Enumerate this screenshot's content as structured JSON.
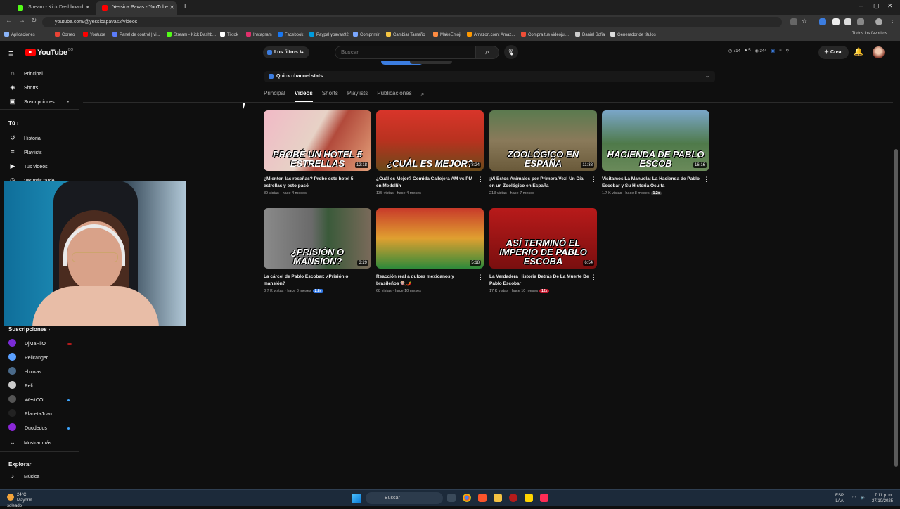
{
  "browser": {
    "tabs": [
      {
        "title": "Stream - Kick Dashboard",
        "color": "#53fc18",
        "active": false
      },
      {
        "title": "Yessica Pavas - YouTube",
        "color": "#ff0000",
        "active": true
      }
    ],
    "url": "youtube.com/@yessicapavas2/videos",
    "bookmarks": [
      {
        "label": "Aplicaciones",
        "color": "#8ab4f8"
      },
      {
        "label": "Correo",
        "color": "#ea4335"
      },
      {
        "label": "Youtube",
        "color": "#ff0000"
      },
      {
        "label": "Panel de control | vi...",
        "color": "#5b7cfa"
      },
      {
        "label": "Stream - Kick Dashb...",
        "color": "#53fc18"
      },
      {
        "label": "Tiktok",
        "color": "#ffffff"
      },
      {
        "label": "Instagram",
        "color": "#e1306c"
      },
      {
        "label": "Facebook",
        "color": "#1877f2"
      },
      {
        "label": "Paypal ypavas92",
        "color": "#009cde"
      },
      {
        "label": "Comprimir",
        "color": "#7aa7ff"
      },
      {
        "label": "Cambiar Tamaño",
        "color": "#f5c542"
      },
      {
        "label": "MakeEmoji",
        "color": "#ff8c42"
      },
      {
        "label": "Amazon.com: Amaz...",
        "color": "#ff9900"
      },
      {
        "label": "Compra tus videojuj...",
        "color": "#f04e37"
      },
      {
        "label": "Daniel Sofia",
        "color": "#cccccc"
      },
      {
        "label": "Generador de títulos",
        "color": "#dddddd"
      }
    ],
    "all_favorites": "Todos los favoritos"
  },
  "yt": {
    "logo_text": "YouTube",
    "logo_sup": "CO",
    "filters_label": "Los filtros",
    "search_placeholder": "Buscar",
    "stats": [
      "714",
      "5",
      "344"
    ],
    "create_label": "Crear"
  },
  "sidebar": {
    "main": [
      {
        "label": "Principal",
        "icon": "home-icon",
        "glyph": "⌂"
      },
      {
        "label": "Shorts",
        "icon": "shorts-icon",
        "glyph": "◈"
      },
      {
        "label": "Suscripciones",
        "icon": "subscriptions-icon",
        "glyph": "▣"
      }
    ],
    "you_label": "Tú",
    "you_items": [
      {
        "label": "Historial",
        "icon": "history-icon",
        "glyph": "↺"
      },
      {
        "label": "Playlists",
        "icon": "playlists-icon",
        "glyph": "≡"
      },
      {
        "label": "Tus videos",
        "icon": "your-videos-icon",
        "glyph": "▶"
      },
      {
        "label": "Ver más tarde",
        "icon": "watch-later-icon",
        "glyph": "◷"
      }
    ],
    "subs_label": "Suscripciones",
    "channels": [
      {
        "label": "DjMaRiiO",
        "color": "#7a2bd6",
        "live": "red"
      },
      {
        "label": "Pelicanger",
        "color": "#5aa0ff",
        "live": ""
      },
      {
        "label": "elxokas",
        "color": "#4a6a8a",
        "live": ""
      },
      {
        "label": "Peli",
        "color": "#cccccc",
        "live": ""
      },
      {
        "label": "WestCOL",
        "color": "#555555",
        "live": "blue"
      },
      {
        "label": "PlanetaJuan",
        "color": "#222222",
        "live": ""
      },
      {
        "label": "Duodedos",
        "color": "#8b28d8",
        "live": "blue"
      }
    ],
    "show_more": "Mostrar más",
    "explore_label": "Explorar",
    "explore_items": [
      {
        "label": "Música",
        "icon": "music-icon",
        "glyph": "♪"
      }
    ]
  },
  "channel": {
    "quick_stats": "Quick channel stats",
    "tabs": [
      "Principal",
      "Videos",
      "Shorts",
      "Playlists",
      "Publicaciones"
    ],
    "active_tab": "Videos"
  },
  "videos": [
    {
      "title": "¿Mienten las reseñas? Probé este hotel 5 estrellas y esto pasó",
      "views": "89 vistas",
      "age": "hace 4 meses",
      "duration": "12:18",
      "caption": "PROBÉ UN HOTEL 5 ESTRELLAS",
      "bg": "linear-gradient(120deg,#f1b9c6 0%,#e7d2c6 45%,#b24a3b 60%,#e3a07a 100%)",
      "badge": "",
      "badge_color": ""
    },
    {
      "title": "¿Cuál es Mejor? Comida Callejera AM vs PM en Medellín",
      "views": "135 vistas",
      "age": "hace 4 meses",
      "duration": "8:24",
      "caption": "¿CUÁL ES MEJOR?",
      "bg": "linear-gradient(180deg,#d8352a 0%,#b8321f 50%,#6a4a1a 100%)",
      "badge": "",
      "badge_color": ""
    },
    {
      "title": "¡Vi Estos Animales por Primera Vez! Un Día en un Zoológico en España",
      "views": "213 vistas",
      "age": "hace 7 meses",
      "duration": "11:38",
      "caption": "ZOOLÓGICO EN ESPAÑA",
      "bg": "linear-gradient(180deg,#5b7a4f 0%,#8a7a5a 50%,#6a5a3a 100%)",
      "badge": "",
      "badge_color": ""
    },
    {
      "title": "Visitamos La Manuela: La Hacienda de Pablo Escobar y Su Historia Oculta",
      "views": "1.7 K vistas",
      "age": "hace 8 meses",
      "duration": "16:16",
      "caption": "HACIENDA DE PABLO ESCOB",
      "bg": "linear-gradient(180deg,#7aa6c8 0%,#4f7a4a 55%,#6a8a5a 100%)",
      "badge": "1.2x",
      "badge_color": "#3a3a3a"
    },
    {
      "title": "La cárcel de Pablo Escobar: ¿Prisión o mansión?",
      "views": "3.7 K vistas",
      "age": "hace 8 meses",
      "duration": "3:29",
      "caption": "¿PRISIÓN O MANSIÓN?",
      "bg": "linear-gradient(90deg,#8a8a8a 0%,#6a6a6a 45%,#3a5a3a 60%,#7a6a5a 100%)",
      "badge": "2.8x",
      "badge_color": "#3178e6"
    },
    {
      "title": "Reacción real a dulces mexicanos y brasileños 🍭🌶️",
      "views": "68 vistas",
      "age": "hace 10 meses",
      "duration": "5:18",
      "caption": "",
      "bg": "linear-gradient(180deg,#c83a2a 0%,#e0a030 50%,#2e8a3a 100%)",
      "badge": "",
      "badge_color": ""
    },
    {
      "title": "La Verdadera Historia Detrás De La Muerte De Pablo Escobar",
      "views": "17 K vistas",
      "age": "hace 10 meses",
      "duration": "6:54",
      "caption": "ASÍ TERMINÓ EL IMPERIO DE PABLO ESCOBA",
      "bg": "linear-gradient(180deg,#b81a1a 0%,#7a0f0f 100%)",
      "badge": "12x",
      "badge_color": "#c0142a"
    }
  ],
  "taskbar": {
    "temperature": "24°C",
    "weather": "Mayorm. soleado",
    "search_label": "Buscar",
    "lang": "ESP",
    "lang2": "LAA",
    "time": "7:11 p. m.",
    "date": "27/10/2025"
  }
}
